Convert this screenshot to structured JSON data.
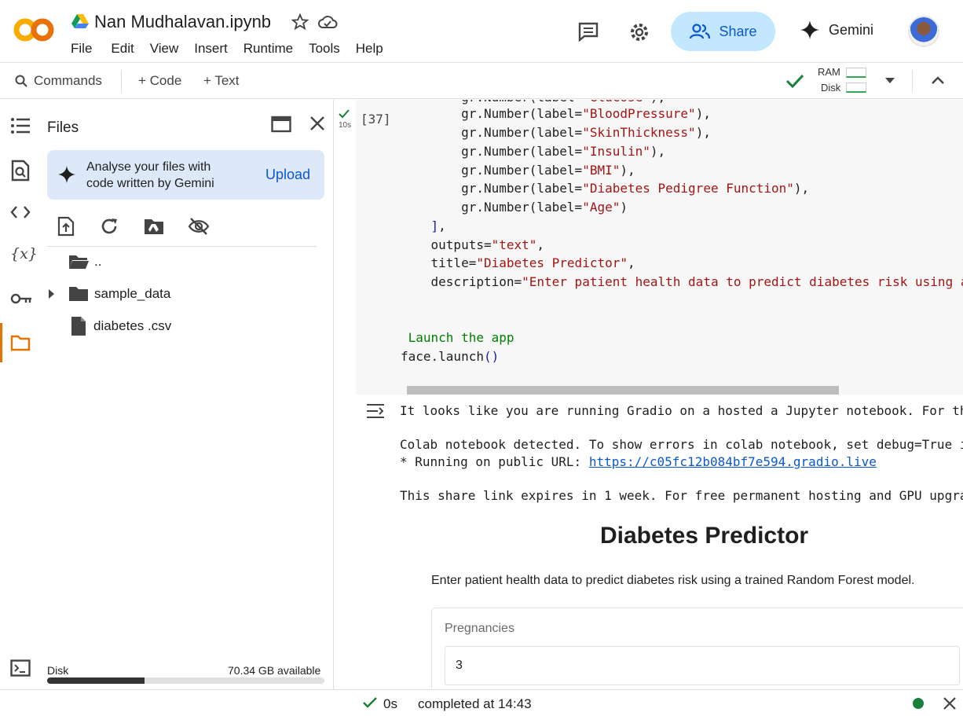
{
  "header": {
    "notebook_title": "Nan Mudhalavan.ipynb",
    "menu": [
      "File",
      "Edit",
      "View",
      "Insert",
      "Runtime",
      "Tools",
      "Help"
    ],
    "share_label": "Share",
    "gemini_label": "Gemini"
  },
  "toolbar": {
    "commands_label": "Commands",
    "code_label": "+ Code",
    "text_label": "+ Text",
    "ram_label": "RAM",
    "disk_label": "Disk"
  },
  "files_panel": {
    "title": "Files",
    "gemini_card_line1": "Analyse your files with",
    "gemini_card_line2": "code written by Gemini",
    "upload_label": "Upload",
    "items": [
      {
        "name": "..",
        "type": "folder-open"
      },
      {
        "name": "sample_data",
        "type": "folder"
      },
      {
        "name": "diabetes .csv",
        "type": "file"
      }
    ],
    "disk_label": "Disk",
    "disk_available": "70.34 GB available",
    "disk_used_fraction": 0.35
  },
  "cell": {
    "run_time": "10s",
    "exec_count": "[37]",
    "code_lines": [
      "        gr.Number(label=\"Glucose\"),",
      "        gr.Number(label=\"BloodPressure\"),",
      "        gr.Number(label=\"SkinThickness\"),",
      "        gr.Number(label=\"Insulin\"),",
      "        gr.Number(label=\"BMI\"),",
      "        gr.Number(label=\"Diabetes Pedigree Function\"),",
      "        gr.Number(label=\"Age\")",
      "    ],",
      "    outputs=\"text\",",
      "    title=\"Diabetes Predictor\",",
      "    description=\"Enter patient health data to predict diabetes risk using a",
      "",
      "",
      " Launch the app",
      "face.launch()"
    ],
    "output": {
      "line1": "It looks like you are running Gradio on a hosted a Jupyter notebook. For th",
      "line2": "Colab notebook detected. To show errors in colab notebook, set debug=True i",
      "line3_prefix": "* Running on public URL: ",
      "url": "https://c05fc12b084bf7e594.gradio.live",
      "line4": "This share link expires in 1 week. For free permanent hosting and GPU upgra"
    },
    "gradio": {
      "title": "Diabetes Predictor",
      "description": "Enter patient health data to predict diabetes risk using a trained Random Forest model.",
      "field_label": "Pregnancies",
      "field_value": "3"
    }
  },
  "statusbar": {
    "duration": "0s",
    "completed": "completed at 14:43"
  }
}
